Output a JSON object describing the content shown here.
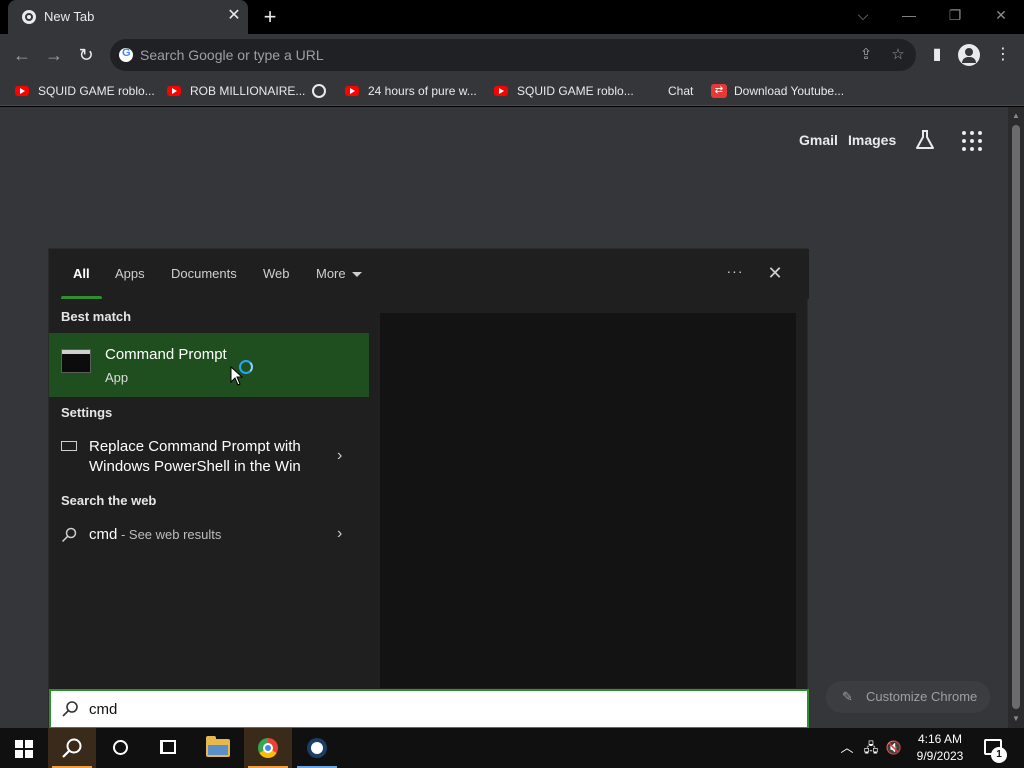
{
  "browser": {
    "tab_title": "New Tab",
    "omnibox_placeholder": "Search Google or type a URL",
    "bookmarks": [
      {
        "label": "SQUID GAME roblo...",
        "icon": "youtube-icon"
      },
      {
        "label": "ROB MILLIONAIRE...",
        "icon": "youtube-icon"
      },
      {
        "label": "",
        "icon": "globe-icon"
      },
      {
        "label": "24 hours of pure w...",
        "icon": "youtube-icon"
      },
      {
        "label": "SQUID GAME roblo...",
        "icon": "youtube-icon"
      },
      {
        "label": "Chat",
        "icon": "blank-icon"
      },
      {
        "label": "Download Youtube...",
        "icon": "download-icon"
      }
    ]
  },
  "newtab_page": {
    "gmail": "Gmail",
    "images": "Images",
    "customize": "Customize Chrome"
  },
  "search_panel": {
    "tabs": [
      "All",
      "Apps",
      "Documents",
      "Web",
      "More"
    ],
    "sections": {
      "best_match": "Best match",
      "settings": "Settings",
      "search_web": "Search the web"
    },
    "best_match_item": {
      "title": "Command Prompt",
      "subtitle": "App"
    },
    "settings_item": {
      "line1": "Replace Command Prompt with",
      "line2": "Windows PowerShell in the Win"
    },
    "web_item": {
      "query": "cmd",
      "suffix": " - See web results"
    },
    "query": "cmd"
  },
  "taskbar": {
    "time": "4:16 AM",
    "date": "9/9/2023",
    "notification_count": "1"
  },
  "colors": {
    "accent_green": "#2f8f2f",
    "best_match_bg": "#1f4f1f",
    "chrome_dark": "#35363a"
  }
}
